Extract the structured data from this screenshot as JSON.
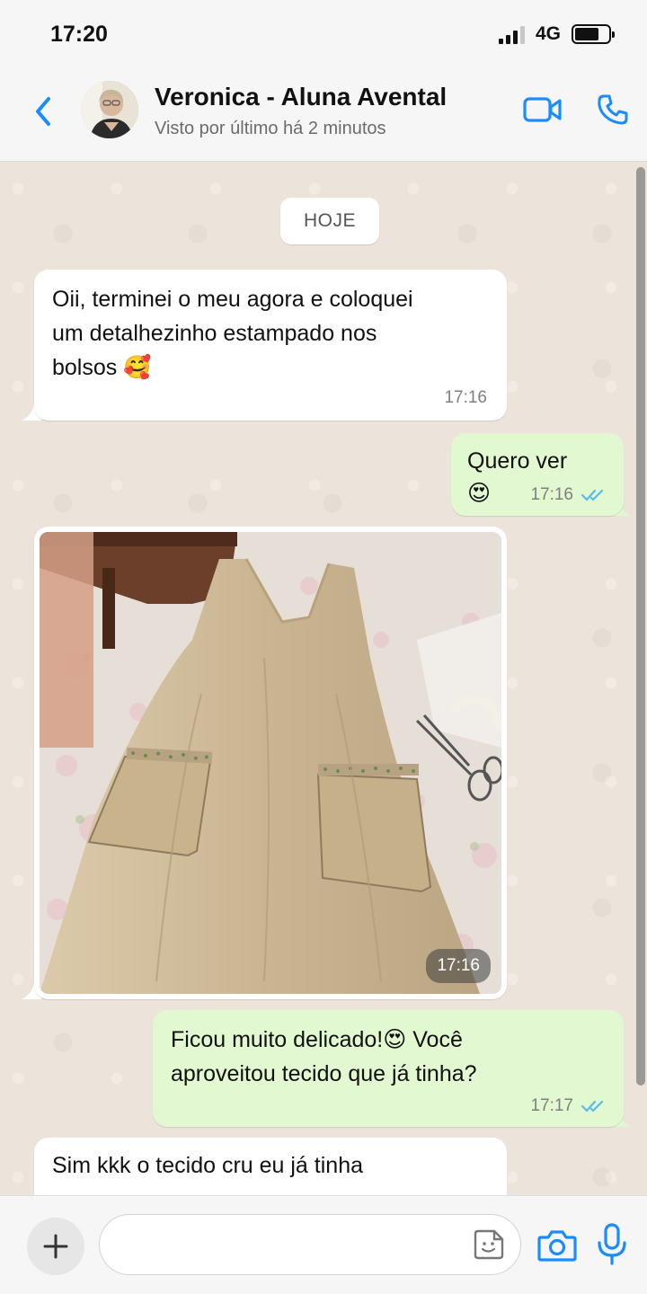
{
  "status_bar": {
    "time": "17:20",
    "network": "4G"
  },
  "header": {
    "contact_name": "Veronica - Aluna Avental",
    "last_seen": "Visto por último há 2 minutos",
    "back_icon": "chevron-left-icon",
    "video_icon": "video-camera-icon",
    "call_icon": "phone-icon"
  },
  "chat": {
    "date_chip": "HOJE",
    "messages": [
      {
        "direction": "in",
        "text_line1": "Oii, terminei o meu agora e coloquei",
        "text_line2": "um detalhezinho estampado nos",
        "text_line3": "bolsos 🥰",
        "time": "17:16"
      },
      {
        "direction": "out",
        "text_line1": "Quero ver",
        "text_line2": "😍",
        "time": "17:16",
        "status": "read"
      },
      {
        "direction": "in",
        "type": "image",
        "time": "17:16"
      },
      {
        "direction": "out",
        "text_line1": "Ficou muito delicado!😍  Você",
        "text_line2": "aproveitou tecido que já tinha?",
        "time": "17:17",
        "status": "read"
      },
      {
        "direction": "in",
        "text_line1": "Sim kkk o tecido cru eu já tinha"
      }
    ]
  },
  "input_bar": {
    "placeholder": "",
    "plus_icon": "plus-icon",
    "sticker_icon": "sticker-icon",
    "camera_icon": "camera-icon",
    "mic_icon": "microphone-icon"
  },
  "colors": {
    "accent": "#1a8cff",
    "outgoing_bubble": "#e2f8d1",
    "incoming_bubble": "#ffffff",
    "chat_background": "#ece4da",
    "read_ticks": "#53bdeb"
  }
}
